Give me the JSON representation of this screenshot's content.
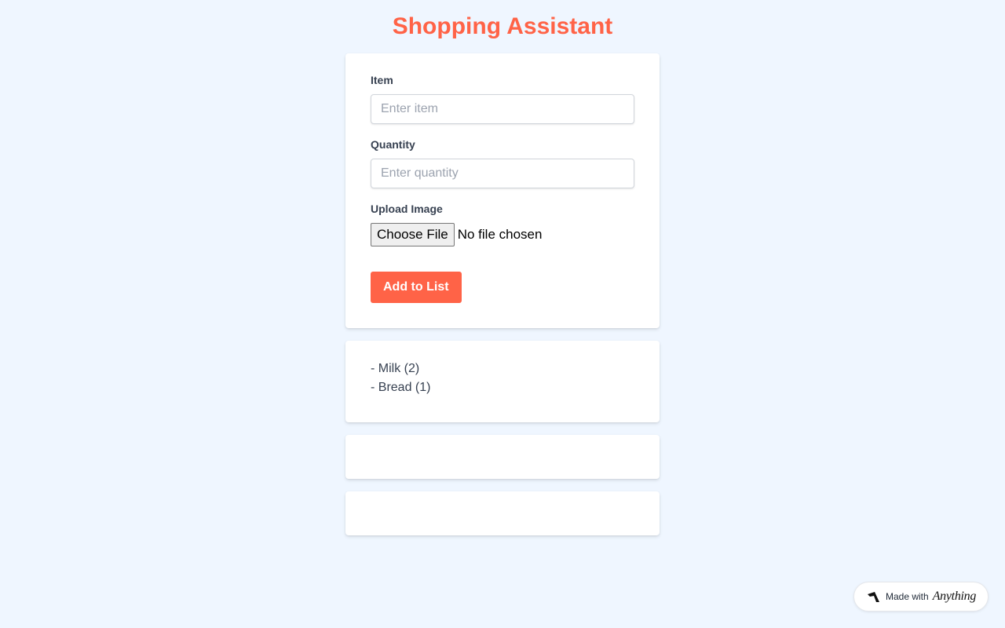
{
  "app": {
    "title": "Shopping Assistant"
  },
  "form": {
    "item_label": "Item",
    "item_placeholder": "Enter item",
    "item_value": "",
    "quantity_label": "Quantity",
    "quantity_placeholder": "Enter quantity",
    "quantity_value": "",
    "upload_label": "Upload Image",
    "file_button_label": "Choose File",
    "file_status": "No file chosen",
    "submit_label": "Add to List"
  },
  "list": {
    "items": [
      "- Milk (2)",
      "- Bread (1)"
    ]
  },
  "badge": {
    "text": "Made with",
    "brand": "Anything",
    "icon": "anything-logo-icon"
  },
  "colors": {
    "accent": "#ff6347",
    "background": "#eff6ff",
    "card": "#ffffff",
    "label": "#374151",
    "placeholder": "#9ca3af"
  }
}
